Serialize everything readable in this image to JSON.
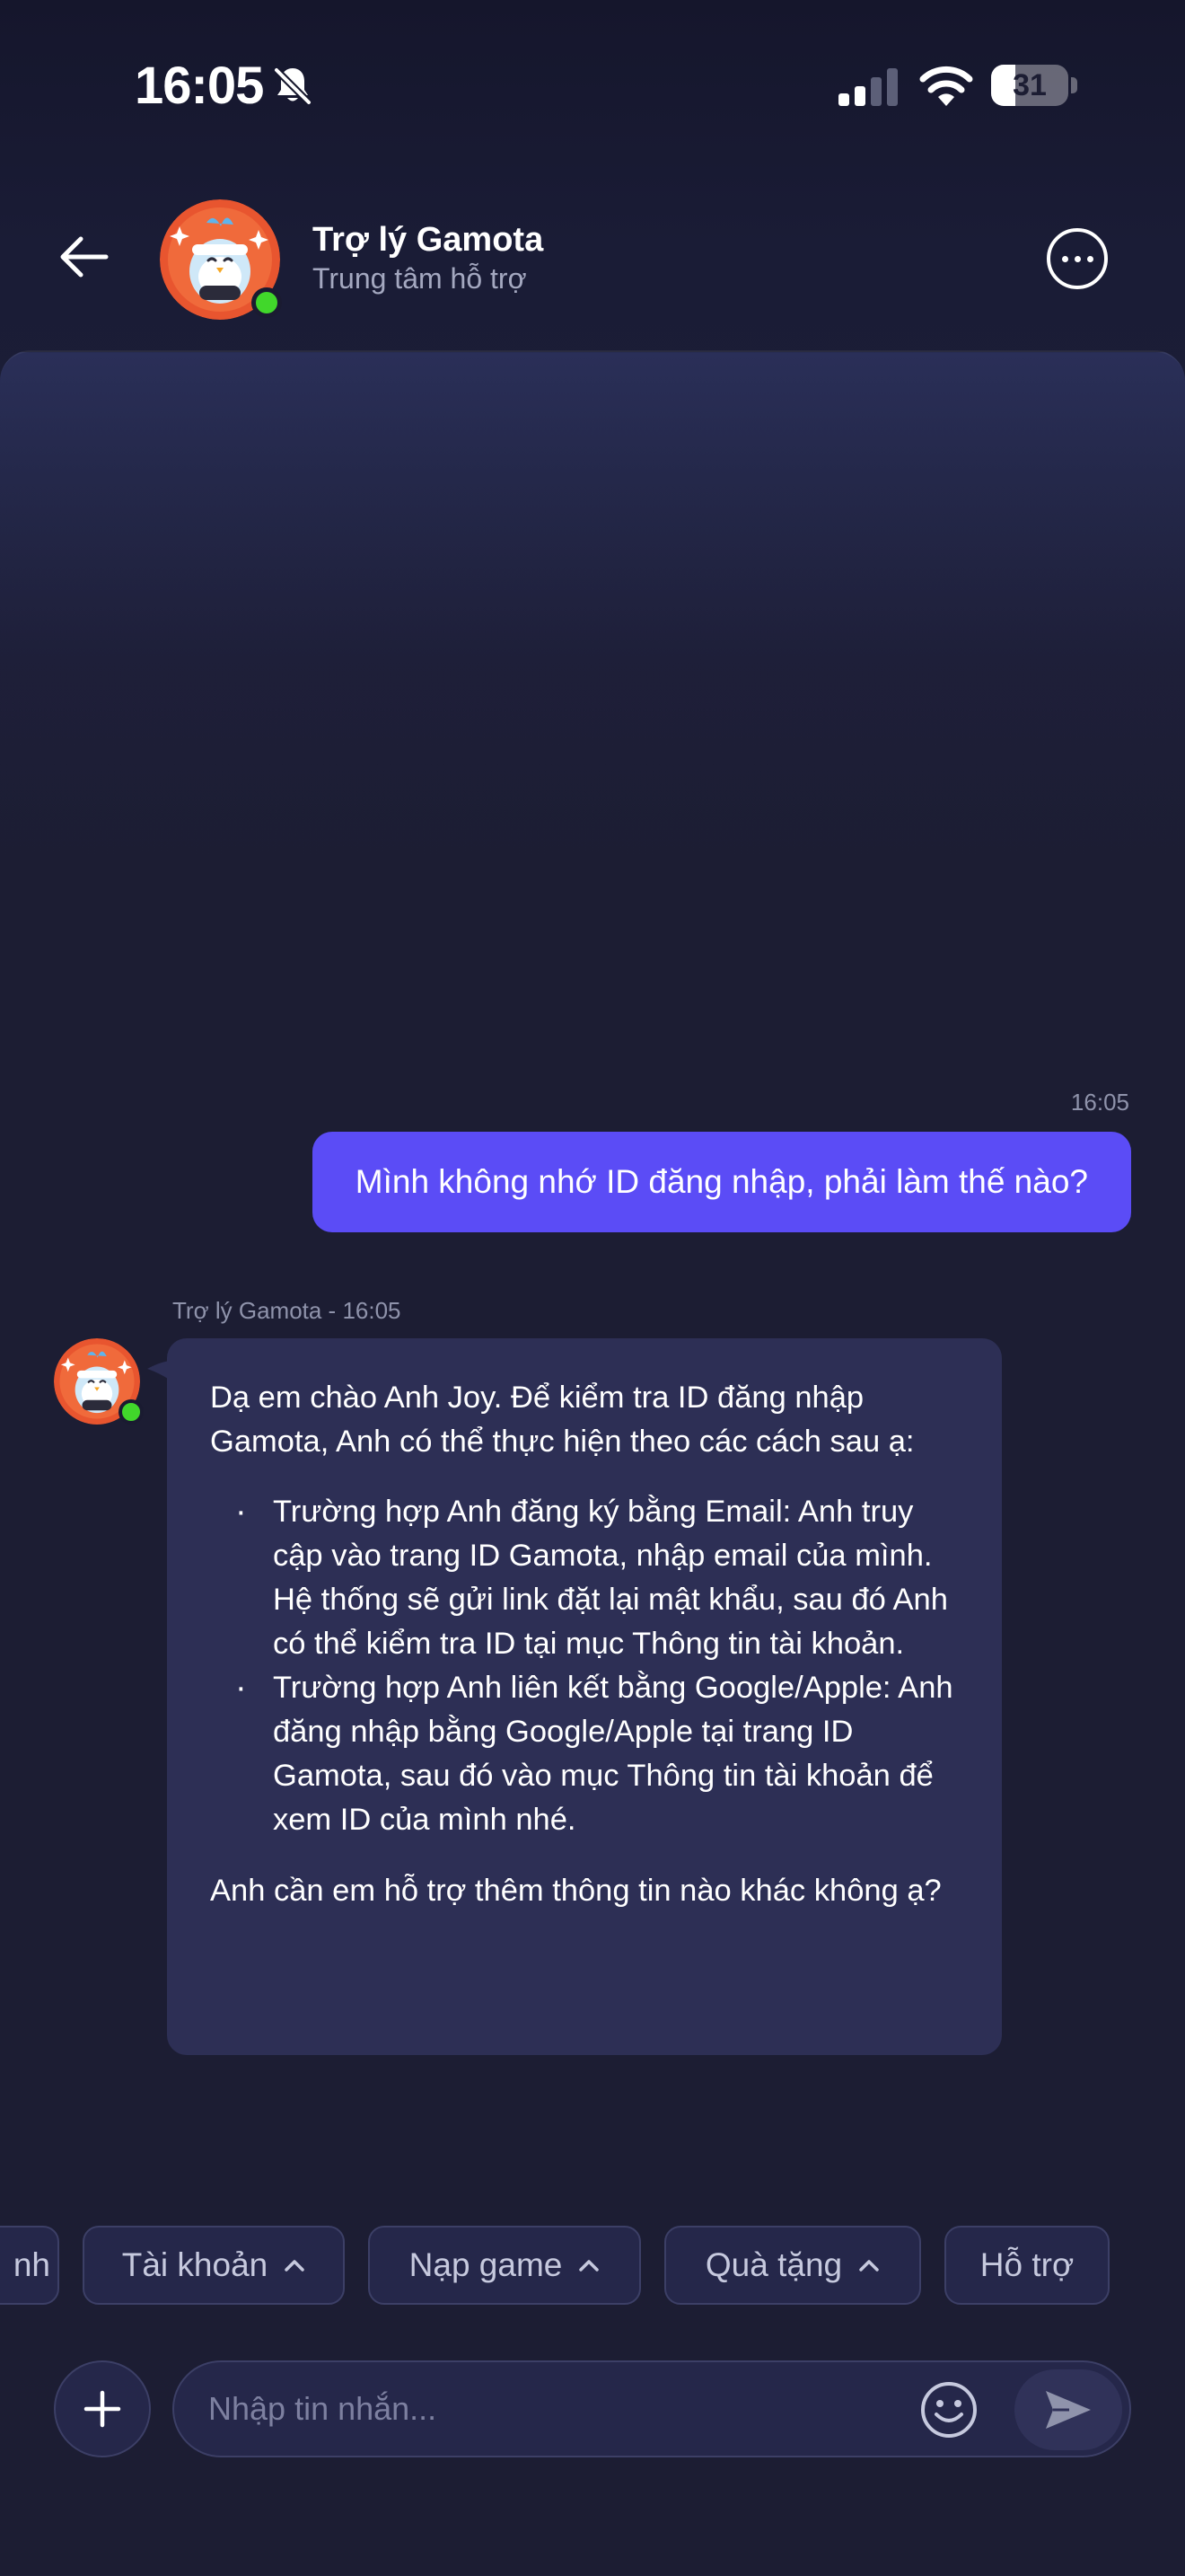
{
  "status_bar": {
    "time": "16:05",
    "battery_level": "31",
    "battery_fraction": 0.31,
    "icons": [
      "bell-slash-icon",
      "cellular-signal-icon",
      "wifi-icon",
      "battery-icon"
    ]
  },
  "header": {
    "title": "Trợ lý Gamota",
    "subtitle": "Trung tâm hỗ trợ",
    "status": "online",
    "icons": [
      "back-arrow-icon",
      "avatar",
      "more-options-icon"
    ]
  },
  "conversation": {
    "user_message": {
      "time": "16:05",
      "text": "Mình không nhớ ID đăng nhập, phải làm thế nào?"
    },
    "bot_message": {
      "meta": "Trợ lý Gamota - 16:05",
      "intro": "Dạ em chào Anh Joy. Để kiểm tra ID đăng nhập Gamota, Anh có thể thực hiện theo các cách sau ạ:",
      "items": [
        "Trường hợp Anh đăng ký bằng Email: Anh truy cập vào trang ID Gamota, nhập email của mình. Hệ thống sẽ gửi link đặt lại mật khẩu, sau đó Anh có thể kiểm tra ID tại mục Thông tin tài khoản.",
        "Trường hợp Anh liên kết bằng Google/Apple: Anh đăng nhập bằng Google/Apple tại trang ID Gamota, sau đó vào mục Thông tin tài khoản để xem ID của mình nhé."
      ],
      "outro": "Anh cần em hỗ trợ thêm thông tin nào khác không ạ?"
    }
  },
  "quick_replies": [
    {
      "label": "nh",
      "has_chevron": false
    },
    {
      "label": "Tài khoản",
      "has_chevron": true
    },
    {
      "label": "Nạp game",
      "has_chevron": true
    },
    {
      "label": "Quà tặng",
      "has_chevron": true
    },
    {
      "label": "Hỗ trợ",
      "has_chevron": false
    }
  ],
  "composer": {
    "placeholder": "Nhập tin nhắn...",
    "icons": [
      "plus-icon",
      "emoji-icon",
      "send-icon"
    ]
  },
  "colors": {
    "background": "#1c1d33",
    "user_bubble": "#5b4cf6",
    "bot_bubble": "#2d2f55",
    "online": "#41d72b",
    "chip_border": "#3c3f66"
  }
}
